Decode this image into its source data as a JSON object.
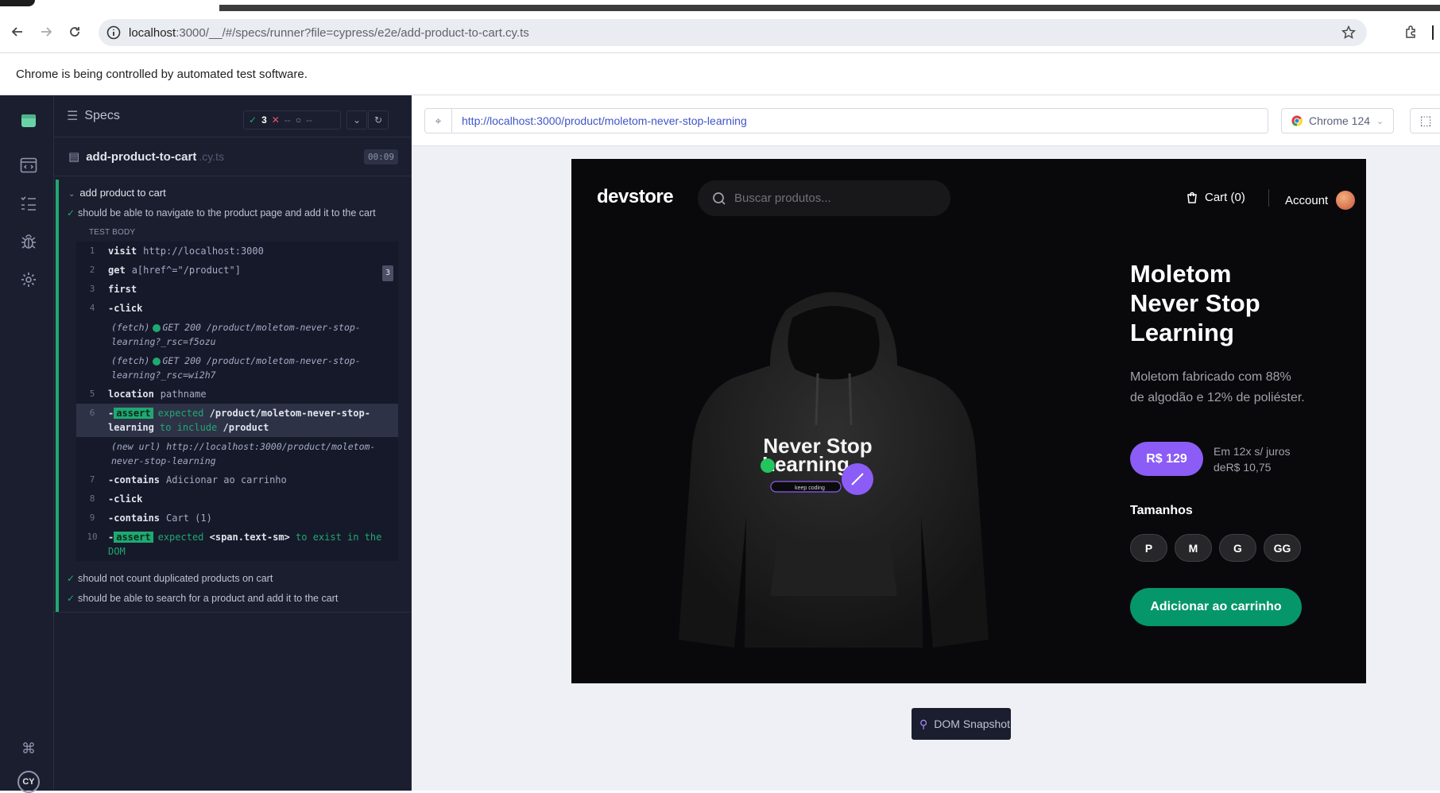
{
  "browser": {
    "url_host": "localhost",
    "url_rest": ":3000/__/#/specs/runner?file=cypress/e2e/add-product-to-cart.cy.ts",
    "infobar": "Chrome is being controlled by automated test software."
  },
  "reporter": {
    "header": "Specs",
    "stats": {
      "passed": "3",
      "failed": "--",
      "pending": "--"
    },
    "spec_name": "add-product-to-cart",
    "spec_ext": ".cy.ts",
    "duration": "00:09",
    "suite": "add product to cart",
    "tests": [
      "should be able to navigate to the product page and add it to the cart",
      "should not count duplicated products on cart",
      "should be able to search for a product and add it to the cart"
    ],
    "test_body_label": "TEST BODY",
    "commands": [
      {
        "num": "1",
        "name": "visit",
        "msg": "http://localhost:3000"
      },
      {
        "num": "2",
        "name": "get",
        "msg": "a[href^=\"/product\"]",
        "badge": "3"
      },
      {
        "num": "3",
        "name": "first",
        "msg": ""
      },
      {
        "num": "4",
        "name": "-click",
        "msg": ""
      },
      {
        "log1": "(fetch)",
        "log1_status": "GET 200 /product/moletom-never-stop-learning?_rsc=f5ozu"
      },
      {
        "log2": "(fetch)",
        "log2_status": "GET 200 /product/moletom-never-stop-learning?_rsc=wi2h7"
      },
      {
        "num": "5",
        "name": "location",
        "msg": "pathname"
      },
      {
        "num": "6",
        "tag": "assert",
        "text_a": "expected",
        "text_b": "/product/moletom-never-stop-learning",
        "text_c": "to include",
        "text_d": "/product"
      },
      {
        "log3": "(new url)",
        "log3_text": "http://localhost:3000/product/moletom-never-stop-learning"
      },
      {
        "num": "7",
        "name": "-contains",
        "msg": "Adicionar ao carrinho"
      },
      {
        "num": "8",
        "name": "-click",
        "msg": ""
      },
      {
        "num": "9",
        "name": "-contains",
        "msg": "Cart (1)"
      },
      {
        "num": "10",
        "tag": "assert",
        "text_a": "expected",
        "text_b": "<span.text-sm>",
        "text_c": "to exist in the DOM"
      }
    ]
  },
  "aut": {
    "url": "http://localhost:3000/product/moletom-never-stop-learning",
    "browser": "Chrome 124",
    "snapshot": "DOM Snapshot"
  },
  "store": {
    "logo": "devstore",
    "search_placeholder": "Buscar produtos...",
    "cart": "Cart (0)",
    "account": "Account",
    "product_title": "Moletom Never Stop Learning",
    "description": "Moletom fabricado com 88% de algodão e 12% de poliéster.",
    "price": "R$ 129",
    "installments": "Em 12x s/ juros deR$ 10,75",
    "sizes_label": "Tamanhos",
    "sizes": [
      "P",
      "M",
      "G",
      "GG"
    ],
    "add_to_cart": "Adicionar ao carrinho",
    "print_line1": "Never Stop",
    "print_line2": "Learning",
    "print_sub": "keep coding"
  },
  "colors": {
    "accent": "#8b5cf6",
    "success": "#059669",
    "cypress_green": "#1fa971"
  }
}
